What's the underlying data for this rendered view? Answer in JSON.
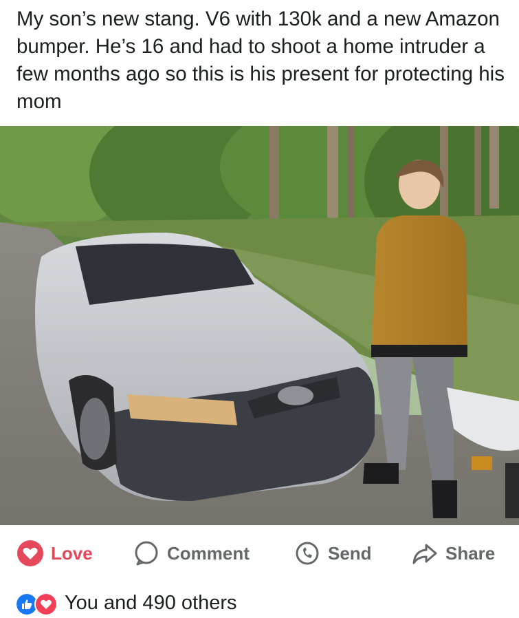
{
  "post": {
    "text": "My son’s new stang. V6 with 130k and a new Amazon bumper. He’s 16 and had to shoot a home intruder a few months ago so this is his present for protecting his mom"
  },
  "photo": {
    "car_badge_icon": "mustang-pony-badge-icon"
  },
  "actions": {
    "love_label": "Love",
    "comment_label": "Comment",
    "send_label": "Send",
    "share_label": "Share",
    "love_color": "#e4485a",
    "label_color": "#65676b"
  },
  "reactions": {
    "summary": "You and 490 others",
    "icons": [
      "like-icon",
      "love-icon"
    ],
    "like_color": "#1877f2",
    "love_color": "#f33e58"
  }
}
